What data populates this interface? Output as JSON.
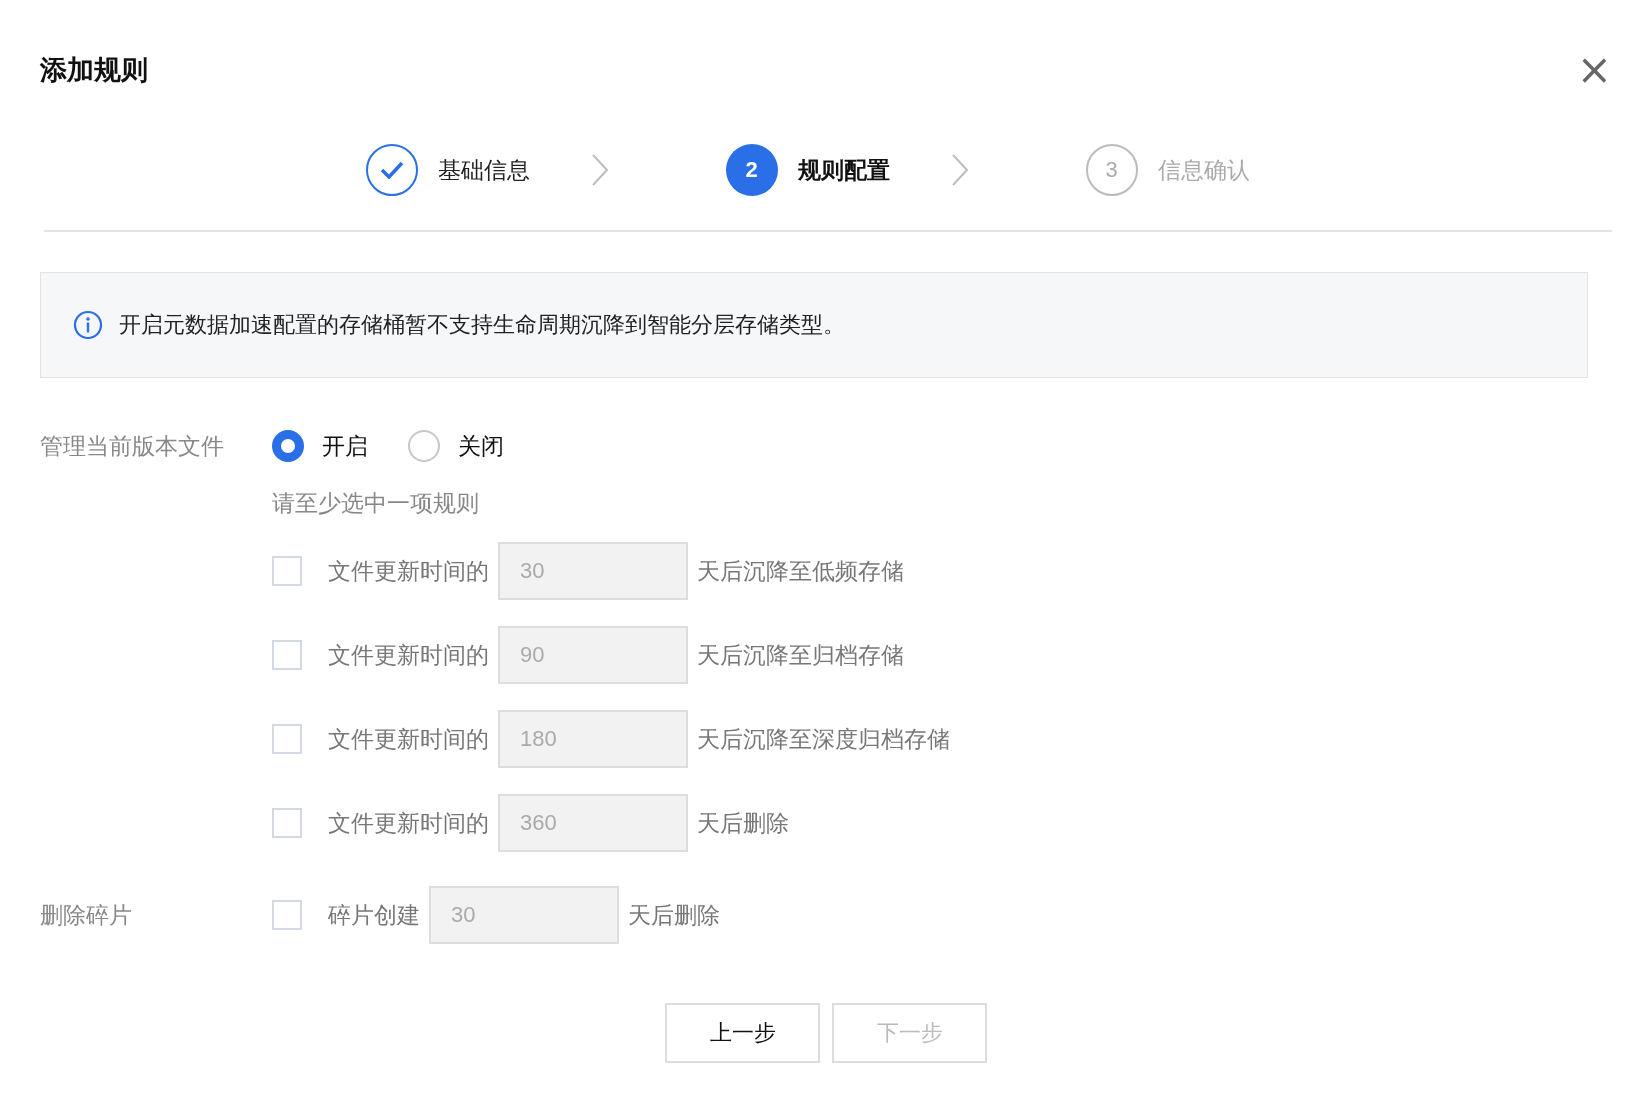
{
  "dialog": {
    "title": "添加规则",
    "close": "×"
  },
  "steps": [
    {
      "label": "基础信息",
      "done": true,
      "selected": false
    },
    {
      "number": "2",
      "label": "规则配置",
      "done": false,
      "selected": true
    },
    {
      "number": "3",
      "label": "信息确认",
      "done": false,
      "selected": false
    }
  ],
  "notice": {
    "text": "开启元数据加速配置的存储桶暂不支持生命周期沉降到智能分层存储类型。"
  },
  "current_version": {
    "label": "管理当前版本文件",
    "options": [
      {
        "label": "开启",
        "selected": true
      },
      {
        "label": "关闭",
        "selected": false
      }
    ],
    "hint": "请至少选中一项规则",
    "rules": [
      {
        "checked": false,
        "prefix": "文件更新时间的",
        "value": "30",
        "disabled": true,
        "suffix": "天后沉降至低频存储"
      },
      {
        "checked": false,
        "prefix": "文件更新时间的",
        "value": "90",
        "disabled": true,
        "suffix": "天后沉降至归档存储"
      },
      {
        "checked": false,
        "prefix": "文件更新时间的",
        "value": "180",
        "disabled": true,
        "suffix": "天后沉降至深度归档存储"
      },
      {
        "checked": false,
        "prefix": "文件更新时间的",
        "value": "360",
        "disabled": true,
        "suffix": "天后删除"
      }
    ]
  },
  "fragments": {
    "label": "删除碎片",
    "rule": {
      "checked": false,
      "prefix": "碎片创建",
      "value": "30",
      "disabled": true,
      "suffix": "天后删除"
    }
  },
  "buttons": [
    {
      "label": "上一步",
      "disabled": false
    },
    {
      "label": "下一步",
      "disabled": true
    }
  ]
}
